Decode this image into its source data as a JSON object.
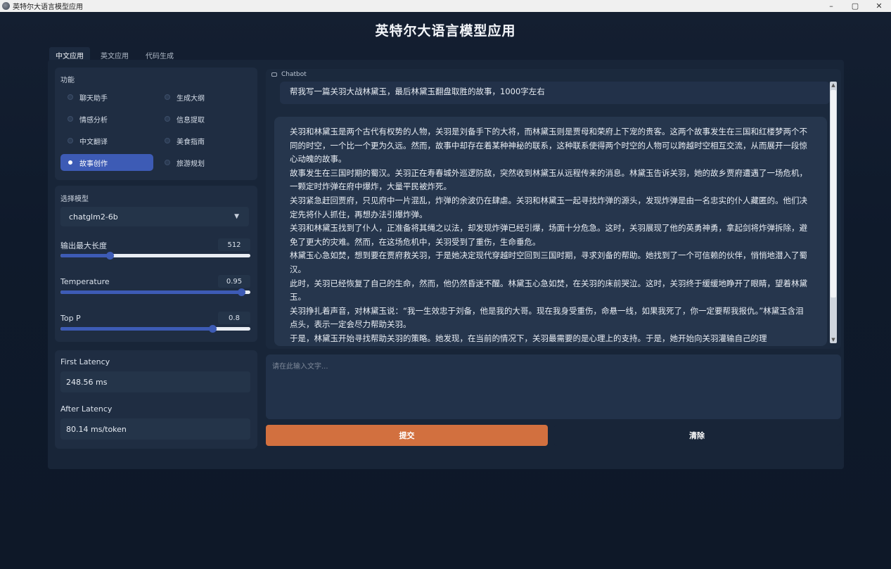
{
  "window": {
    "title": "英特尔大语言模型应用",
    "controls": {
      "minimize": "–",
      "maximize": "▢",
      "close": "✕"
    }
  },
  "page_title": "英特尔大语言模型应用",
  "tabs": [
    {
      "label": "中文应用",
      "active": true
    },
    {
      "label": "英文应用",
      "active": false
    },
    {
      "label": "代码生成",
      "active": false
    }
  ],
  "function_group": {
    "label": "功能",
    "selected": "故事创作",
    "options": [
      "聊天助手",
      "生成大纲",
      "情感分析",
      "信息提取",
      "中文翻译",
      "美食指南",
      "故事创作",
      "旅游规划"
    ]
  },
  "model": {
    "label": "选择模型",
    "selected": "chatglm2-6b",
    "sliders": [
      {
        "label": "输出最大长度",
        "value": "512",
        "fraction": 0.26
      },
      {
        "label": "Temperature",
        "value": "0.95",
        "fraction": 0.95
      },
      {
        "label": "Top P",
        "value": "0.8",
        "fraction": 0.8
      }
    ]
  },
  "latency": {
    "first_label": "First Latency",
    "first_value": "248.56 ms",
    "after_label": "After Latency",
    "after_value": "80.14 ms/token"
  },
  "chatbot": {
    "label": "Chatbot",
    "user_message": "帮我写一篇关羽大战林黛玉，最后林黛玉翻盘取胜的故事，1000字左右",
    "bot_paragraphs": [
      "关羽和林黛玉是两个古代有权势的人物，关羽是刘备手下的大将，而林黛玉则是贾母和荣府上下宠的贵客。这两个故事发生在三国和红楼梦两个不同的时空，一个比一个更为久远。然而，故事中却存在着某种神秘的联系，这种联系使得两个时空的人物可以跨越时空相互交流，从而展开一段惊心动魄的故事。",
      "故事发生在三国时期的蜀汉。关羽正在寿春城外巡逻防敌，突然收到林黛玉从远程传来的消息。林黛玉告诉关羽，她的故乡贾府遭遇了一场危机，一颗定时炸弹在府中爆炸，大量平民被炸死。",
      "关羽紧急赶回贾府，只见府中一片混乱，炸弹的余波仍在肆虐。关羽和林黛玉一起寻找炸弹的源头，发现炸弹是由一名忠实的仆人藏匿的。他们决定先将仆人抓住，再想办法引爆炸弹。",
      "关羽和林黛玉找到了仆人，正准备将其绳之以法，却发现炸弹已经引爆，场面十分危急。这时，关羽展现了他的英勇神勇，拿起剑将炸弹拆除，避免了更大的灾难。然而，在这场危机中，关羽受到了重伤，生命垂危。",
      "林黛玉心急如焚，想到要在贾府救关羽，于是她决定现代穿越时空回到三国时期，寻求刘备的帮助。她找到了一个可信赖的伙伴，悄悄地潜入了蜀汉。",
      "此时，关羽已经恢复了自己的生命，然而，他仍然昏迷不醒。林黛玉心急如焚，在关羽的床前哭泣。这时，关羽终于缓缓地睁开了眼睛，望着林黛玉。",
      "关羽挣扎着声音，对林黛玉说：“我一生效忠于刘备，他是我的大哥。现在我身受重伤，命悬一线，如果我死了，你一定要帮我报仇。”林黛玉含泪点头，表示一定会尽力帮助关羽。",
      "于是，林黛玉开始寻找帮助关羽的策略。她发现，在当前的情况下，关羽最需要的是心理上的支持。于是，她开始向关羽灌输自己的理"
    ]
  },
  "input": {
    "placeholder": "请在此输入文字..."
  },
  "buttons": {
    "submit": "提交",
    "clear": "清除"
  },
  "colors": {
    "accent": "#3d5bb5",
    "submit": "#d2703f",
    "background": "#0f1a2b"
  }
}
